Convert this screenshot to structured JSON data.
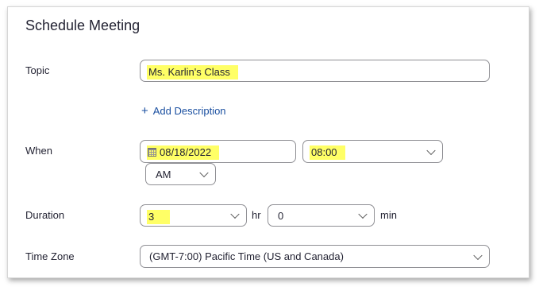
{
  "heading": "Schedule Meeting",
  "topic": {
    "label": "Topic",
    "value": "Ms. Karlin's Class"
  },
  "description": {
    "plus": "+",
    "label": "Add Description"
  },
  "when": {
    "label": "When",
    "date": "08/18/2022",
    "time": "08:00",
    "ampm": "AM"
  },
  "duration": {
    "label": "Duration",
    "hours": "3",
    "hr_unit": "hr",
    "minutes": "0",
    "min_unit": "min"
  },
  "timezone": {
    "label": "Time Zone",
    "value": "(GMT-7:00) Pacific Time (US and Canada)"
  },
  "colors": {
    "highlight": "#ffff66",
    "link": "#1a4fa0"
  }
}
